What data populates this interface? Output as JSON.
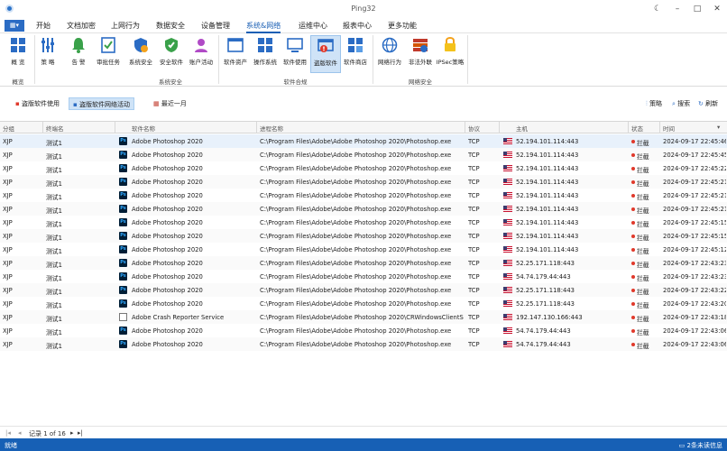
{
  "window": {
    "title": "Ping32"
  },
  "menu": {
    "items": [
      "开始",
      "文档加密",
      "上网行为",
      "数据安全",
      "设备管理",
      "系统&网络",
      "运维中心",
      "报表中心",
      "更多功能"
    ],
    "active": "系统&网络"
  },
  "ribbon": {
    "groups": [
      {
        "name": "概览",
        "buttons": [
          {
            "label": "概 览",
            "icon": "overview-icon"
          }
        ]
      },
      {
        "name": "系统安全",
        "buttons": [
          {
            "label": "策 略",
            "icon": "policy-icon"
          },
          {
            "label": "告 警",
            "icon": "alarm-bell-icon"
          },
          {
            "label": "审批任务",
            "icon": "approval-task-icon"
          },
          {
            "label": "系统安全",
            "icon": "system-security-shield-icon"
          },
          {
            "label": "安全软件",
            "icon": "security-software-shield-icon"
          },
          {
            "label": "账户活动",
            "icon": "account-activity-icon"
          }
        ]
      },
      {
        "name": "软件合规",
        "buttons": [
          {
            "label": "软件资产",
            "icon": "software-assets-icon"
          },
          {
            "label": "操作系统",
            "icon": "operating-system-icon"
          },
          {
            "label": "软件使用",
            "icon": "software-usage-icon"
          },
          {
            "label": "盗版软件",
            "icon": "pirated-software-icon"
          },
          {
            "label": "软件商店",
            "icon": "software-store-icon"
          }
        ]
      },
      {
        "name": "网络安全",
        "buttons": [
          {
            "label": "网络行为",
            "icon": "network-behavior-icon"
          },
          {
            "label": "非法外联",
            "icon": "illegal-outbound-icon"
          },
          {
            "label": "IPSec策略",
            "icon": "ipsec-policy-icon"
          }
        ]
      }
    ],
    "selected": "盗版软件"
  },
  "toolbar": {
    "tab1": "盗版软件使用",
    "tab2": "盗版软件网络活动",
    "range": "最近一月",
    "policy": "策略",
    "search": "搜索",
    "refresh": "刷新"
  },
  "table": {
    "columns": [
      "分组",
      "终端名",
      "软件名称",
      "进程名称",
      "协议",
      "主机",
      "状态",
      "时间"
    ],
    "rows": [
      {
        "group": "XJP",
        "terminal": "测试1",
        "software": "Adobe Photoshop 2020",
        "process": "C:\\Program Files\\Adobe\\Adobe Photoshop 2020\\Photoshop.exe",
        "protocol": "TCP",
        "host": "52.194.101.114:443",
        "status": "拦截",
        "time": "2024-09-17 22:45:46",
        "app": "ps"
      },
      {
        "group": "XJP",
        "terminal": "测试1",
        "software": "Adobe Photoshop 2020",
        "process": "C:\\Program Files\\Adobe\\Adobe Photoshop 2020\\Photoshop.exe",
        "protocol": "TCP",
        "host": "52.194.101.114:443",
        "status": "拦截",
        "time": "2024-09-17 22:45:45",
        "app": "ps"
      },
      {
        "group": "XJP",
        "terminal": "测试1",
        "software": "Adobe Photoshop 2020",
        "process": "C:\\Program Files\\Adobe\\Adobe Photoshop 2020\\Photoshop.exe",
        "protocol": "TCP",
        "host": "52.194.101.114:443",
        "status": "拦截",
        "time": "2024-09-17 22:45:22",
        "app": "ps"
      },
      {
        "group": "XJP",
        "terminal": "测试1",
        "software": "Adobe Photoshop 2020",
        "process": "C:\\Program Files\\Adobe\\Adobe Photoshop 2020\\Photoshop.exe",
        "protocol": "TCP",
        "host": "52.194.101.114:443",
        "status": "拦截",
        "time": "2024-09-17 22:45:21",
        "app": "ps"
      },
      {
        "group": "XJP",
        "terminal": "测试1",
        "software": "Adobe Photoshop 2020",
        "process": "C:\\Program Files\\Adobe\\Adobe Photoshop 2020\\Photoshop.exe",
        "protocol": "TCP",
        "host": "52.194.101.114:443",
        "status": "拦截",
        "time": "2024-09-17 22:45:21",
        "app": "ps"
      },
      {
        "group": "XJP",
        "terminal": "测试1",
        "software": "Adobe Photoshop 2020",
        "process": "C:\\Program Files\\Adobe\\Adobe Photoshop 2020\\Photoshop.exe",
        "protocol": "TCP",
        "host": "52.194.101.114:443",
        "status": "拦截",
        "time": "2024-09-17 22:45:21",
        "app": "ps"
      },
      {
        "group": "XJP",
        "terminal": "测试1",
        "software": "Adobe Photoshop 2020",
        "process": "C:\\Program Files\\Adobe\\Adobe Photoshop 2020\\Photoshop.exe",
        "protocol": "TCP",
        "host": "52.194.101.114:443",
        "status": "拦截",
        "time": "2024-09-17 22:45:15",
        "app": "ps"
      },
      {
        "group": "XJP",
        "terminal": "测试1",
        "software": "Adobe Photoshop 2020",
        "process": "C:\\Program Files\\Adobe\\Adobe Photoshop 2020\\Photoshop.exe",
        "protocol": "TCP",
        "host": "52.194.101.114:443",
        "status": "拦截",
        "time": "2024-09-17 22:45:15",
        "app": "ps"
      },
      {
        "group": "XJP",
        "terminal": "测试1",
        "software": "Adobe Photoshop 2020",
        "process": "C:\\Program Files\\Adobe\\Adobe Photoshop 2020\\Photoshop.exe",
        "protocol": "TCP",
        "host": "52.194.101.114:443",
        "status": "拦截",
        "time": "2024-09-17 22:45:12",
        "app": "ps"
      },
      {
        "group": "XJP",
        "terminal": "测试1",
        "software": "Adobe Photoshop 2020",
        "process": "C:\\Program Files\\Adobe\\Adobe Photoshop 2020\\Photoshop.exe",
        "protocol": "TCP",
        "host": "52.25.171.118:443",
        "status": "拦截",
        "time": "2024-09-17 22:43:23",
        "app": "ps"
      },
      {
        "group": "XJP",
        "terminal": "测试1",
        "software": "Adobe Photoshop 2020",
        "process": "C:\\Program Files\\Adobe\\Adobe Photoshop 2020\\Photoshop.exe",
        "protocol": "TCP",
        "host": "54.74.179.44:443",
        "status": "拦截",
        "time": "2024-09-17 22:43:23",
        "app": "ps"
      },
      {
        "group": "XJP",
        "terminal": "测试1",
        "software": "Adobe Photoshop 2020",
        "process": "C:\\Program Files\\Adobe\\Adobe Photoshop 2020\\Photoshop.exe",
        "protocol": "TCP",
        "host": "52.25.171.118:443",
        "status": "拦截",
        "time": "2024-09-17 22:43:22",
        "app": "ps"
      },
      {
        "group": "XJP",
        "terminal": "测试1",
        "software": "Adobe Photoshop 2020",
        "process": "C:\\Program Files\\Adobe\\Adobe Photoshop 2020\\Photoshop.exe",
        "protocol": "TCP",
        "host": "52.25.171.118:443",
        "status": "拦截",
        "time": "2024-09-17 22:43:20",
        "app": "ps"
      },
      {
        "group": "XJP",
        "terminal": "测试1",
        "software": "Adobe Crash Reporter Service",
        "process": "C:\\Program Files\\Adobe\\Adobe Photoshop 2020\\CRWindowsClientS...",
        "protocol": "TCP",
        "host": "192.147.130.166:443",
        "status": "拦截",
        "time": "2024-09-17 22:43:18",
        "app": "cr"
      },
      {
        "group": "XJP",
        "terminal": "测试1",
        "software": "Adobe Photoshop 2020",
        "process": "C:\\Program Files\\Adobe\\Adobe Photoshop 2020\\Photoshop.exe",
        "protocol": "TCP",
        "host": "54.74.179.44:443",
        "status": "拦截",
        "time": "2024-09-17 22:43:06",
        "app": "ps"
      },
      {
        "group": "XJP",
        "terminal": "测试1",
        "software": "Adobe Photoshop 2020",
        "process": "C:\\Program Files\\Adobe\\Adobe Photoshop 2020\\Photoshop.exe",
        "protocol": "TCP",
        "host": "54.74.179.44:443",
        "status": "拦截",
        "time": "2024-09-17 22:43:06",
        "app": "ps"
      }
    ]
  },
  "pager": {
    "record": "记录 1 of 16"
  },
  "statusbar": {
    "left": "就绪",
    "right": "2条未读信息"
  },
  "colors": {
    "accent": "#1a5fb4",
    "statusbar": "#1760b5",
    "blocked": "#e0392b"
  }
}
